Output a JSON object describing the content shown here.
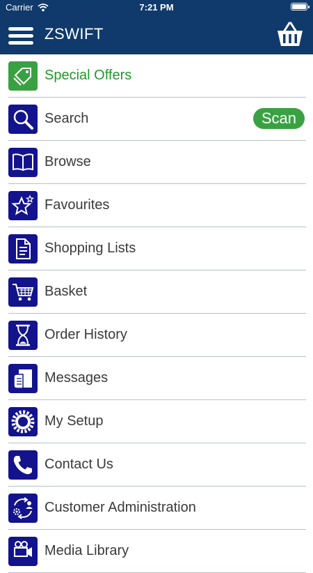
{
  "status_bar": {
    "carrier": "Carrier",
    "time": "7:21 PM"
  },
  "navbar": {
    "title": "ZSWIFT"
  },
  "menu": {
    "items": [
      {
        "label": "Special Offers",
        "icon": "tag-icon"
      },
      {
        "label": "Search",
        "icon": "search-icon",
        "action": "Scan"
      },
      {
        "label": "Browse",
        "icon": "book-icon"
      },
      {
        "label": "Favourites",
        "icon": "star-icon"
      },
      {
        "label": "Shopping Lists",
        "icon": "document-icon"
      },
      {
        "label": "Basket",
        "icon": "cart-icon"
      },
      {
        "label": "Order History",
        "icon": "hourglass-icon"
      },
      {
        "label": "Messages",
        "icon": "message-icon"
      },
      {
        "label": "My Setup",
        "icon": "gear-icon"
      },
      {
        "label": "Contact Us",
        "icon": "phone-icon"
      },
      {
        "label": "Customer Administration",
        "icon": "users-icon"
      },
      {
        "label": "Media Library",
        "icon": "media-icon"
      }
    ]
  },
  "colors": {
    "header": "#0f3a6b",
    "icon_bg": "#13138d",
    "accent_green": "#3aa142"
  }
}
